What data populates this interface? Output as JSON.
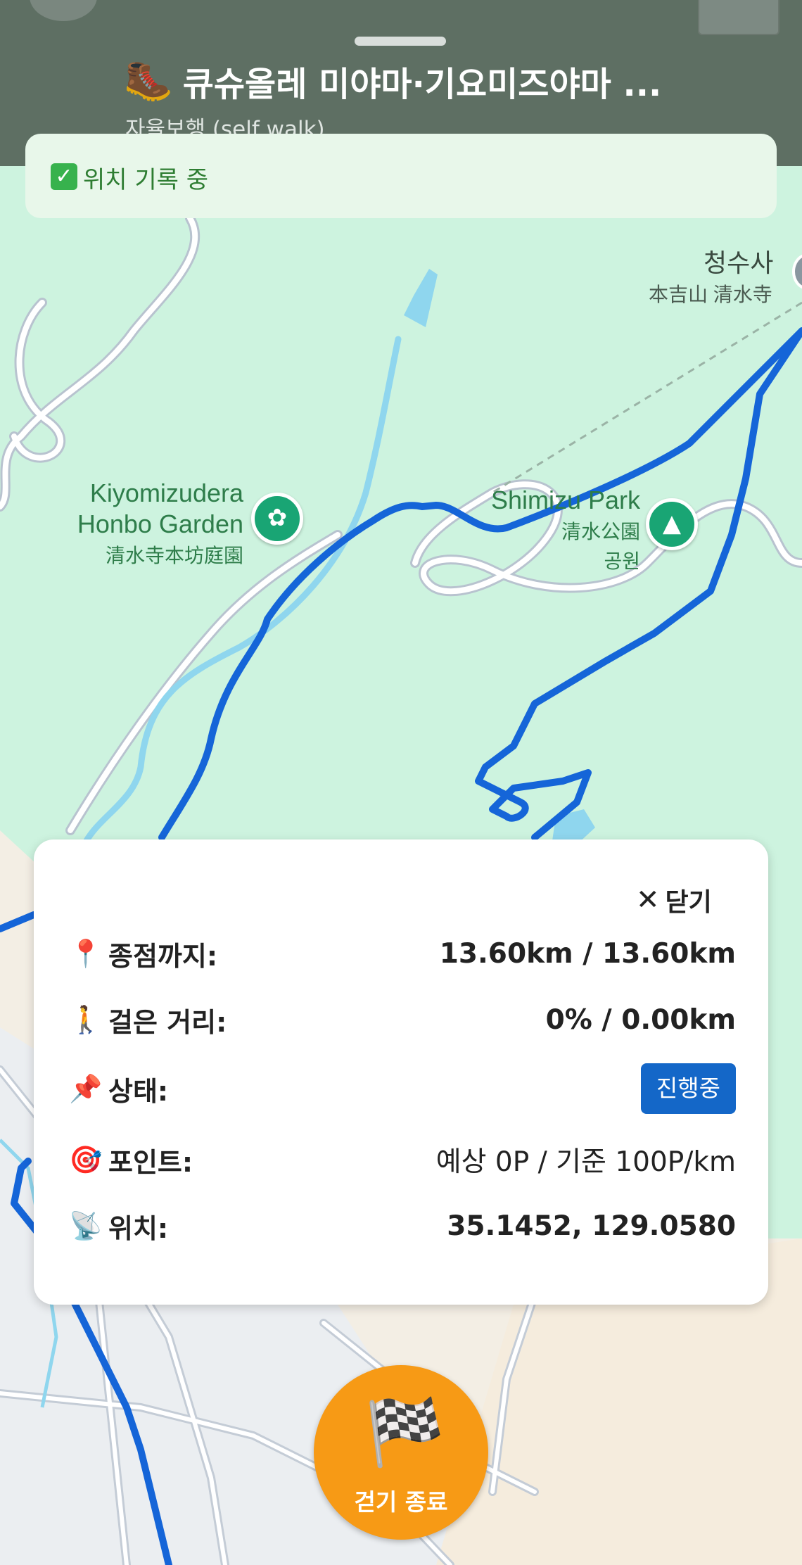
{
  "header": {
    "title": "큐슈올레 미야마·기요미즈야마 ...",
    "subtitle": "자율보행 (self walk)",
    "title_icon": "boot-icon"
  },
  "recording": {
    "text": "위치 기록 중",
    "icon": "check-icon"
  },
  "map": {
    "labels": {
      "temple_ko": "청수사",
      "temple_jp": "本吉山 清水寺",
      "garden_en_1": "Kiyomizudera",
      "garden_en_2": "Honbo Garden",
      "garden_jp": "清水寺本坊庭園",
      "park_en": "Shimizu Park",
      "park_jp": "清水公園",
      "park_ko": "공원"
    },
    "colors": {
      "land": "#cdf3df",
      "route": "#1565d8",
      "water": "#8fd6ee",
      "road": "#ffffff"
    }
  },
  "panel": {
    "close_label": "닫기",
    "rows": [
      {
        "icon": "📍",
        "label": "종점까지:",
        "value": "13.60km / 13.60km"
      },
      {
        "icon": "🚶",
        "label": "걸은 거리:",
        "value": "0% / 0.00km"
      },
      {
        "icon": "📌",
        "label": "상태:",
        "value": "진행중"
      },
      {
        "icon": "🎯",
        "label": "포인트:",
        "value": "예상 0P / 기준 100P/km"
      },
      {
        "icon": "📡",
        "label": "위치:",
        "value": "35.1452, 129.0580"
      }
    ]
  },
  "end_button": {
    "label": "걷기 종료",
    "icon": "🏁"
  }
}
